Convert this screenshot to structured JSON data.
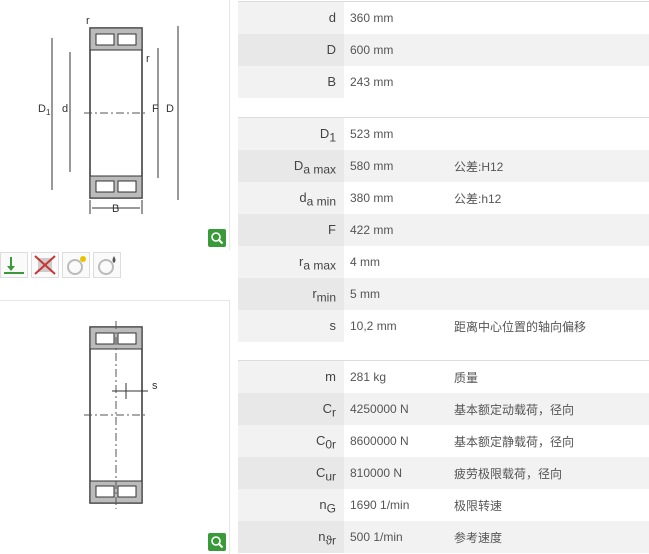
{
  "groups": [
    {
      "rows": [
        {
          "label": "d",
          "sub": "",
          "value": "360  mm",
          "note": ""
        },
        {
          "label": "D",
          "sub": "",
          "value": "600  mm",
          "note": ""
        },
        {
          "label": "B",
          "sub": "",
          "value": "243  mm",
          "note": ""
        }
      ]
    },
    {
      "rows": [
        {
          "label": "D",
          "sub": "1",
          "value": "523  mm",
          "note": ""
        },
        {
          "label": "D",
          "sub": "a max",
          "value": "580  mm",
          "note": "公差:H12"
        },
        {
          "label": "d",
          "sub": "a min",
          "value": "380  mm",
          "note": "公差:h12"
        },
        {
          "label": "F",
          "sub": "",
          "value": "422  mm",
          "note": ""
        },
        {
          "label": "r",
          "sub": "a max",
          "value": "4  mm",
          "note": ""
        },
        {
          "label": "r",
          "sub": "min",
          "value": "5  mm",
          "note": ""
        },
        {
          "label": "s",
          "sub": "",
          "value": "10,2  mm",
          "note": "距离中心位置的轴向偏移"
        }
      ]
    },
    {
      "rows": [
        {
          "label": "m",
          "sub": "",
          "value": "281  kg",
          "note": "质量"
        },
        {
          "label": "C",
          "sub": "r",
          "value": "4250000  N",
          "note": "基本额定动载荷，径向"
        },
        {
          "label": "C",
          "sub": "0r",
          "value": "8600000  N",
          "note": "基本额定静载荷，径向"
        },
        {
          "label": "C",
          "sub": "ur",
          "value": "810000  N",
          "note": "疲劳极限载荷，径向"
        },
        {
          "label": "n",
          "sub": "G",
          "value": "1690  1/min",
          "note": "极限转速"
        },
        {
          "label": "n",
          "sub": "ϑr",
          "value": "500  1/min",
          "note": "参考速度"
        }
      ]
    }
  ],
  "drawing_labels": {
    "top": {
      "r1": "r",
      "r2": "r",
      "d1": "D",
      "d1_sub": "1",
      "d": "d",
      "f": "F",
      "dd": "D",
      "b": "B"
    },
    "bottom": {
      "s": "s"
    }
  },
  "colors": {
    "zoom": "#3a9a3a",
    "label_bg": "#f2f2f2",
    "stripe": "#f2f2f2"
  }
}
